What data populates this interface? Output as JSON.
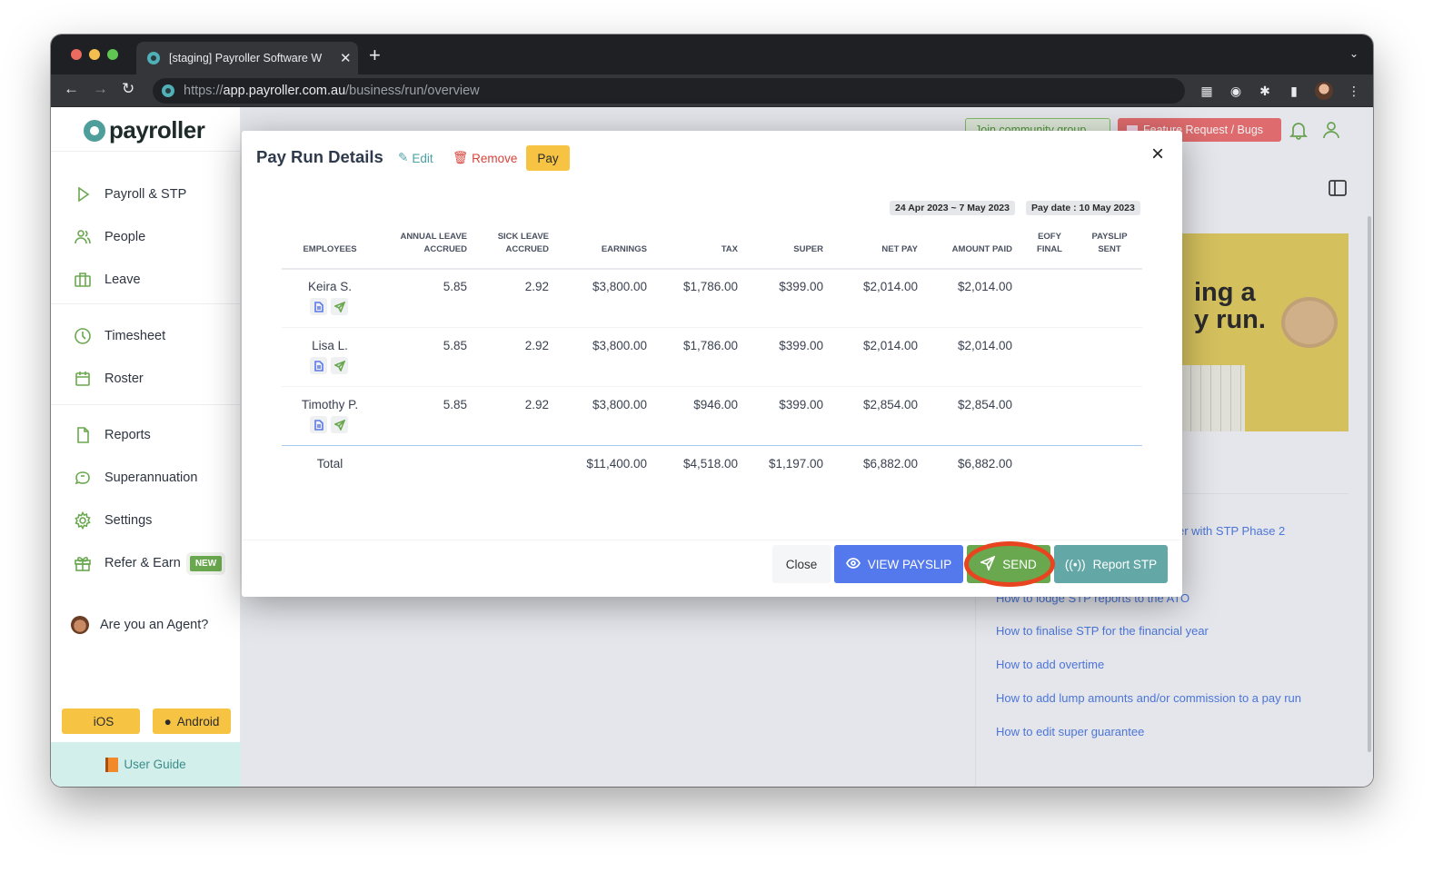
{
  "browser": {
    "tab_title": "[staging] Payroller Software W",
    "url_scheme": "https://",
    "url_host": "app.payroller.com.au",
    "url_path": "/business/run/overview"
  },
  "sidebar": {
    "brand": "payroller",
    "items": [
      {
        "label": "Payroll & STP",
        "icon": "play-icon"
      },
      {
        "label": "People",
        "icon": "people-icon"
      },
      {
        "label": "Leave",
        "icon": "briefcase-icon"
      },
      {
        "label": "Timesheet",
        "icon": "clock-icon"
      },
      {
        "label": "Roster",
        "icon": "calendar-icon"
      },
      {
        "label": "Reports",
        "icon": "file-icon"
      },
      {
        "label": "Superannuation",
        "icon": "piggy-bank-icon"
      },
      {
        "label": "Settings",
        "icon": "gear-icon"
      },
      {
        "label": "Refer & Earn",
        "icon": "gift-icon",
        "badge": "NEW"
      }
    ],
    "agent_label": "Are you an Agent?",
    "ios_label": "iOS",
    "android_label": "Android",
    "user_guide_label": "User Guide"
  },
  "topbar": {
    "join_label": "Join community group",
    "feature_label": "Feature Request / Bugs"
  },
  "promo": {
    "text": "ing a\ny run."
  },
  "help_links": [
    "er with STP Phase 2",
    "How to lodge STP reports to the ATO",
    "How to finalise STP for the financial year",
    "How to add overtime",
    "How to add lump amounts and/or commission to a pay run",
    "How to edit super guarantee"
  ],
  "modal": {
    "title": "Pay Run Details",
    "edit_label": "Edit",
    "remove_label": "Remove",
    "pay_label": "Pay",
    "period": "24 Apr 2023 ~ 7 May 2023",
    "pay_date": "Pay date : 10 May 2023",
    "columns": [
      "EMPLOYEES",
      "ANNUAL LEAVE\nACCRUED",
      "SICK LEAVE\nACCRUED",
      "EARNINGS",
      "TAX",
      "SUPER",
      "NET PAY",
      "AMOUNT PAID",
      "EOFY\nFINAL",
      "PAYSLIP\nSENT"
    ],
    "rows": [
      {
        "name": "Keira S.",
        "annual_leave": "5.85",
        "sick_leave": "2.92",
        "earnings": "$3,800.00",
        "tax": "$1,786.00",
        "super": "$399.00",
        "net_pay": "$2,014.00",
        "amount_paid": "$2,014.00"
      },
      {
        "name": "Lisa L.",
        "annual_leave": "5.85",
        "sick_leave": "2.92",
        "earnings": "$3,800.00",
        "tax": "$1,786.00",
        "super": "$399.00",
        "net_pay": "$2,014.00",
        "amount_paid": "$2,014.00"
      },
      {
        "name": "Timothy P.",
        "annual_leave": "5.85",
        "sick_leave": "2.92",
        "earnings": "$3,800.00",
        "tax": "$946.00",
        "super": "$399.00",
        "net_pay": "$2,854.00",
        "amount_paid": "$2,854.00"
      }
    ],
    "total": {
      "label": "Total",
      "earnings": "$11,400.00",
      "tax": "$4,518.00",
      "super": "$1,197.00",
      "net_pay": "$6,882.00",
      "amount_paid": "$6,882.00"
    },
    "footer": {
      "close_label": "Close",
      "view_payslip_label": "VIEW PAYSLIP",
      "send_label": "SEND",
      "report_stp_label": "Report STP"
    }
  },
  "colors": {
    "brand_green": "#6aa84f",
    "teal": "#63a8a7",
    "blue": "#5479ec",
    "yellow": "#f6c343",
    "red": "#d9433b",
    "highlight": "#e8441f"
  }
}
